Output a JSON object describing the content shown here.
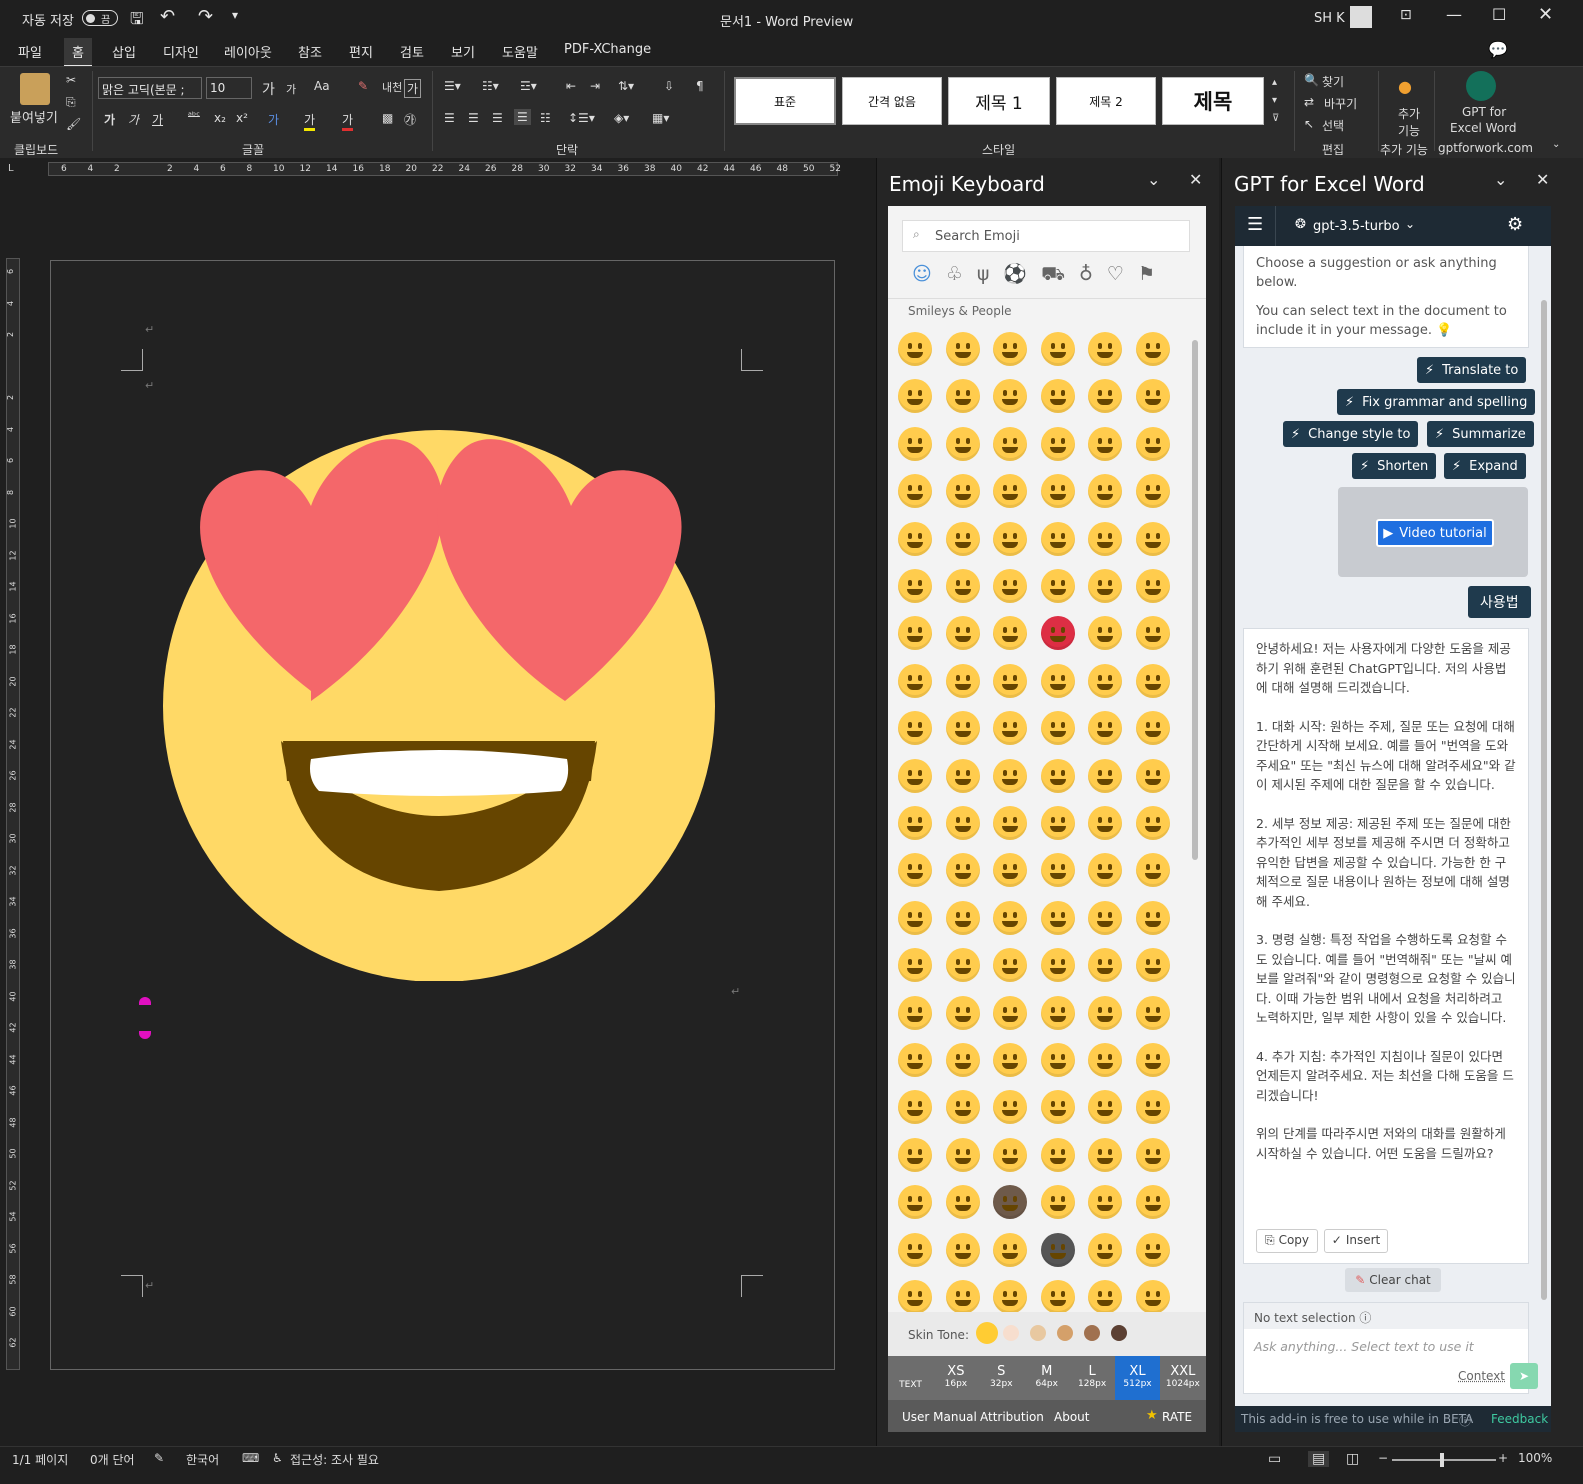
{
  "titlebar": {
    "autosave": "자동 저장",
    "toggle": "끔",
    "doc_title": "문서1  -  Word Preview",
    "user": "SH K"
  },
  "menu": [
    "파일",
    "홈",
    "삽입",
    "디자인",
    "레이아웃",
    "참조",
    "편지",
    "검토",
    "보기",
    "도움말",
    "PDF-XChange"
  ],
  "ribbon": {
    "clipboard": {
      "paste": "붙여넣기",
      "label": "클립보드"
    },
    "font": {
      "name": "맑은 고딕(본문 ;",
      "size": "10",
      "label": "글꼴",
      "case": "Aa"
    },
    "paragraph": {
      "label": "단락"
    },
    "styles": {
      "items": [
        "표준",
        "간격 없음",
        "제목 1",
        "제목 2",
        "제목"
      ],
      "label": "스타일"
    },
    "editing": {
      "find": "찾기",
      "replace": "바꾸기",
      "select": "선택",
      "label": "편집"
    },
    "addins": {
      "more": "추가\n기능",
      "label": "추가 기능"
    },
    "gpt": {
      "line1": "GPT for",
      "line2": "Excel Word",
      "label": "gptforwork.com"
    }
  },
  "ruler_h": [
    "6",
    "4",
    "2",
    "",
    "2",
    "4",
    "6",
    "8",
    "10",
    "12",
    "14",
    "16",
    "18",
    "20",
    "22",
    "24",
    "26",
    "28",
    "30",
    "32",
    "34",
    "36",
    "38",
    "40",
    "42",
    "44",
    "46",
    "48",
    "50",
    "52"
  ],
  "ruler_v": [
    "6",
    "4",
    "2",
    "",
    "2",
    "4",
    "6",
    "8",
    "10",
    "12",
    "14",
    "16",
    "18",
    "20",
    "22",
    "24",
    "26",
    "28",
    "30",
    "32",
    "34",
    "36",
    "38",
    "40",
    "42",
    "44",
    "46",
    "48",
    "50",
    "52",
    "54",
    "56",
    "58",
    "60",
    "62"
  ],
  "emoji_pane": {
    "title": "Emoji Keyboard",
    "search_placeholder": "Search Emoji",
    "category": "Smileys & People",
    "skin_tone_label": "Skin Tone:",
    "skin_tones": [
      "#ffcc33",
      "#f7dece",
      "#e8c8a0",
      "#d4a06a",
      "#a0714f",
      "#5c4033"
    ],
    "sizes": [
      {
        "name": "TEXT",
        "px": ""
      },
      {
        "name": "XS",
        "px": "16px"
      },
      {
        "name": "S",
        "px": "32px"
      },
      {
        "name": "M",
        "px": "64px"
      },
      {
        "name": "L",
        "px": "128px"
      },
      {
        "name": "XL",
        "px": "512px"
      },
      {
        "name": "XXL",
        "px": "1024px"
      }
    ],
    "footer": [
      "User Manual",
      "Attribution",
      "About"
    ],
    "rate": "RATE"
  },
  "gpt_pane": {
    "title": "GPT for Excel Word",
    "model": "gpt-3.5-turbo",
    "intro1": "Choose a suggestion or ask anything below.",
    "intro2": "You can select text in the document to include it in your message. 💡",
    "chips": [
      "Translate to",
      "Fix grammar and spelling",
      "Change style to",
      "Summarize",
      "Shorten",
      "Expand"
    ],
    "video": "Video tutorial",
    "user_msg": "사용법",
    "reply": [
      "안녕하세요! 저는 사용자에게 다양한 도움을 제공하기 위해 훈련된 ChatGPT입니다. 저의 사용법에 대해 설명해 드리겠습니다.",
      "1. 대화 시작: 원하는 주제, 질문 또는 요청에 대해 간단하게 시작해 보세요. 예를 들어 \"번역을 도와주세요\" 또는 \"최신 뉴스에 대해 알려주세요\"와 같이 제시된 주제에 대한 질문을 할 수 있습니다.",
      "2. 세부 정보 제공: 제공된 주제 또는 질문에 대한 추가적인 세부 정보를 제공해 주시면 더 정확하고 유익한 답변을 제공할 수 있습니다. 가능한 한 구체적으로 질문 내용이나 원하는 정보에 대해 설명해 주세요.",
      "3. 명령 실행: 특정 작업을 수행하도록 요청할 수도 있습니다. 예를 들어 \"번역해줘\" 또는 \"날씨 예보를 알려줘\"와 같이 명령형으로 요청할 수 있습니다. 이때 가능한 범위 내에서 요청을 처리하려고 노력하지만, 일부 제한 사항이 있을 수 있습니다.",
      "4. 추가 지침: 추가적인 지침이나 질문이 있다면 언제든지 알려주세요. 저는 최선을 다해 도움을 드리겠습니다!",
      "위의 단계를 따라주시면 저와의 대화를 원활하게 시작하실 수 있습니다. 어떤 도움을 드릴까요?"
    ],
    "copy": "Copy",
    "insert": "Insert",
    "clear": "Clear chat",
    "no_selection": "No text selection",
    "ask_placeholder": "Ask anything... Select text to use it",
    "context": "Context",
    "beta": "This add-in is free to use while in BETA",
    "feedback": "Feedback"
  },
  "statusbar": {
    "page": "1/1 페이지",
    "words": "0개 단어",
    "lang": "한국어",
    "access": "접근성: 조사 필요",
    "zoom": "100%"
  },
  "colors": {
    "accent": "#1f3a4d",
    "heart": "#f4676a",
    "face": "#ffd966",
    "mouth": "#664500"
  }
}
